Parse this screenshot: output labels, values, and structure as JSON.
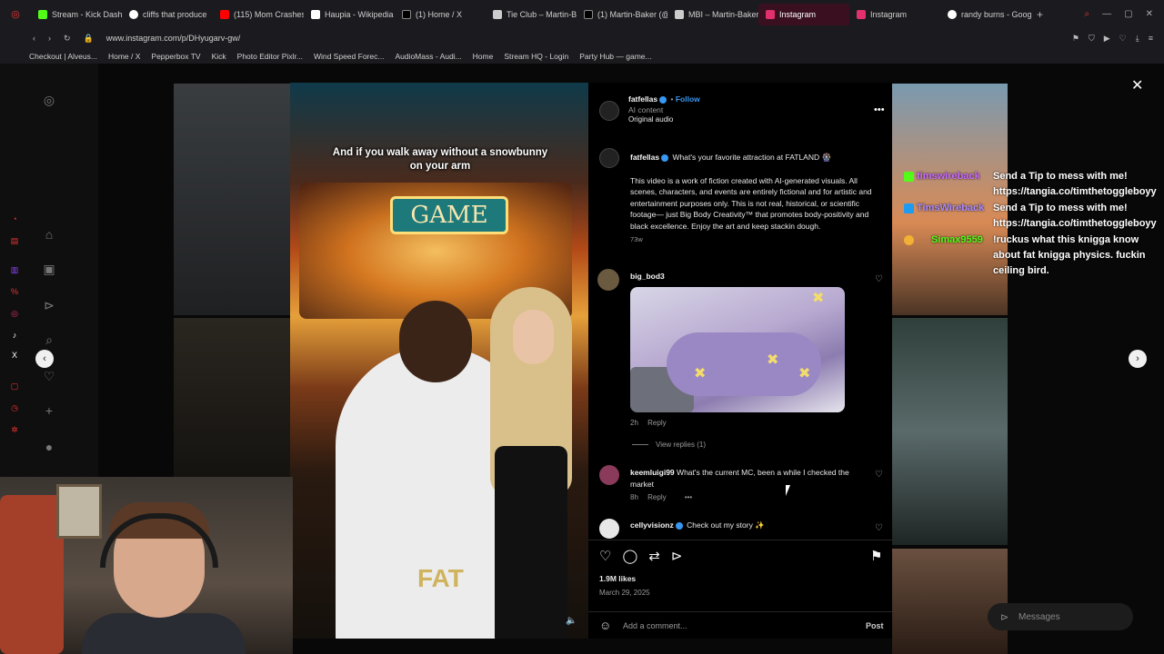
{
  "browser": {
    "tabs": [
      {
        "label": "Stream - Kick Dash",
        "color": "#53fc18"
      },
      {
        "label": "cliffs that produce",
        "color": "#ffffff"
      },
      {
        "label": "(115) Mom Crashes",
        "color": "#ff0000"
      },
      {
        "label": "Haupia - Wikipedia",
        "color": "#ffffff"
      },
      {
        "label": "(1) Home / X",
        "color": "#ffffff"
      },
      {
        "label": "Tie Club – Martin-B",
        "color": "#dddddd"
      },
      {
        "label": "(1) Martin-Baker (@",
        "color": "#ffffff"
      },
      {
        "label": "MBI – Martin-Baker",
        "color": "#dddddd"
      },
      {
        "label": "Instagram",
        "color": "#e1306c",
        "active": true
      },
      {
        "label": "Instagram",
        "color": "#e1306c"
      },
      {
        "label": "randy burns - Goog",
        "color": "#ffffff"
      }
    ],
    "url": "www.instagram.com/p/DHyugarv-gw/",
    "bookmarks": [
      "Checkout | Alveus...",
      "Home / X",
      "Pepperbox TV",
      "Kick",
      "Photo Editor Pixlr...",
      "Wind Speed Forec...",
      "AudioMass - Audi...",
      "Home",
      "Stream HQ - Login",
      "Party Hub — game..."
    ]
  },
  "video": {
    "caption": "And if you walk away without a snowbunny on your arm",
    "watermark": "FAT"
  },
  "post": {
    "author": "fatfellas",
    "follow_label": "Follow",
    "ai_label": "AI content",
    "audio_label": "Original audio",
    "caption_title": "What's your favorite attraction at FATLAND 🎡",
    "caption_body": "This video is a work of fiction created with AI-generated visuals. All scenes, characters, and events are entirely fictional and for artistic and entertainment purposes only. This is not real, historical, or scientific footage— just Big Body Creativity™ that promotes body-positivity and black excellence. Enjoy the art and keep stackin dough.",
    "caption_age": "73w",
    "likes": "1.9M likes",
    "date": "March 29, 2025",
    "add_comment_placeholder": "Add a comment...",
    "post_label": "Post"
  },
  "comments": [
    {
      "user": "big_bod3",
      "age": "2h",
      "reply_label": "Reply",
      "view_replies": "View replies (1)"
    },
    {
      "user": "keemluigi99",
      "text": "What's the current MC, been a while I checked the market",
      "age": "8h",
      "reply_label": "Reply"
    },
    {
      "user": "cellyvisionz",
      "text": "Check out my story ✨"
    }
  ],
  "chat": [
    {
      "user": "timswireback",
      "user_color": "#c86bff",
      "message": "Send a Tip to mess with me! https://tangia.co/timthetoggleboyy"
    },
    {
      "user": "TimsWireback",
      "user_color": "#a98bff",
      "message": "Send a Tip to mess with me! https://tangia.co/timthetoggleboyy"
    },
    {
      "user": "Simax9559",
      "user_color": "#53fc18",
      "message": "!ruckus what this knigga know about fat knigga physics. fuckin ceiling bird."
    }
  ],
  "messages_label": "Messages",
  "colors": {
    "accent": "#3897f0",
    "kick_green": "#53fc18"
  }
}
